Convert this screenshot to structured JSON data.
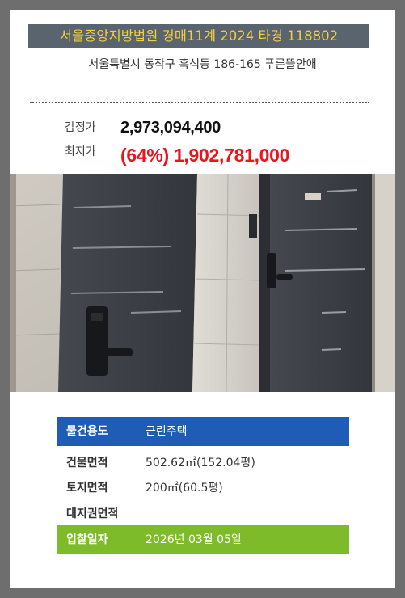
{
  "header": {
    "title": "서울중앙지방법원 경매11계 2024 타경 118802",
    "address": "서울특별시 동작구 흑석동 186-165 푸른뜰안애"
  },
  "prices": {
    "appraisal_label": "감정가",
    "appraisal_value": "2,973,094,400",
    "minimum_label": "최저가",
    "minimum_value": "(64%) 1,902,781,000"
  },
  "photo": {
    "description": "doors-photo"
  },
  "details": {
    "usage_label": "물건용도",
    "usage_value": "근린주택",
    "building_area_label": "건물면적",
    "building_area_value": "502.62㎡(152.04평)",
    "land_area_label": "토지면적",
    "land_area_value": "200㎡(60.5평)",
    "land_right_label": "대지권면적",
    "land_right_value": "",
    "bid_date_label": "입찰일자",
    "bid_date_value": "2026년 03월 05일"
  },
  "colors": {
    "background": "#6e6e6e",
    "banner": "#5a646e",
    "banner_text": "#f2cf3c",
    "min_price": "#e8151b",
    "usage_band": "#1f5cb5",
    "date_band": "#7dbb2b"
  }
}
